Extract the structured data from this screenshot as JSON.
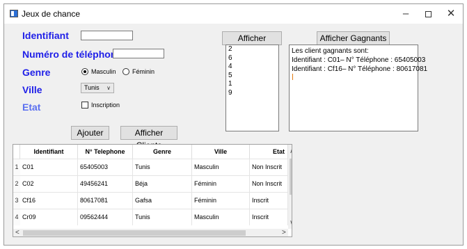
{
  "window": {
    "title": "Jeux de chance"
  },
  "form": {
    "identifiant_label": "Identifiant",
    "phone_label": "Numéro de téléphone",
    "genre_label": "Genre",
    "ville_label": "Ville",
    "etat_label": "Etat",
    "identifiant_value": "",
    "phone_value": "",
    "genre_options": [
      "Masculin",
      "Féminin"
    ],
    "genre_selected": "Masculin",
    "ville_value": "Tunis",
    "inscription_label": "Inscription",
    "inscription_checked": false
  },
  "buttons": {
    "afficher_chance": "Afficher Chance",
    "afficher_gagnants": "Afficher Gagnants",
    "ajouter": "Ajouter",
    "afficher_clients": "Afficher Clients"
  },
  "chance_numbers": [
    "2",
    "6",
    "4",
    "5",
    "1",
    "9"
  ],
  "gagnants": {
    "lines": [
      "Les client gagnants sont:",
      "Identifiant : C01– N° Téléphone : 65405003",
      "Identifiant : Cf16– N° Téléphone : 80617081"
    ]
  },
  "table": {
    "columns": [
      "Identifiant",
      "N° Telephone",
      "Genre",
      "Ville",
      "Etat"
    ],
    "rows": [
      {
        "num": "1",
        "cells": [
          "C01",
          "65405003",
          "Tunis",
          "Masculin",
          "Non Inscrit"
        ]
      },
      {
        "num": "2",
        "cells": [
          "C02",
          "49456241",
          "Béja",
          "Féminin",
          "Non Inscrit"
        ]
      },
      {
        "num": "3",
        "cells": [
          "Cf16",
          "80617081",
          "Gafsa",
          "Féminin",
          "Inscrit"
        ]
      },
      {
        "num": "4",
        "cells": [
          "Cr09",
          "09562444",
          "Tunis",
          "Masculin",
          "Inscrit"
        ]
      }
    ]
  },
  "icons": {
    "app": "app-window-icon",
    "minimize": "minimize-icon",
    "maximize": "maximize-icon",
    "close": "close-icon"
  }
}
